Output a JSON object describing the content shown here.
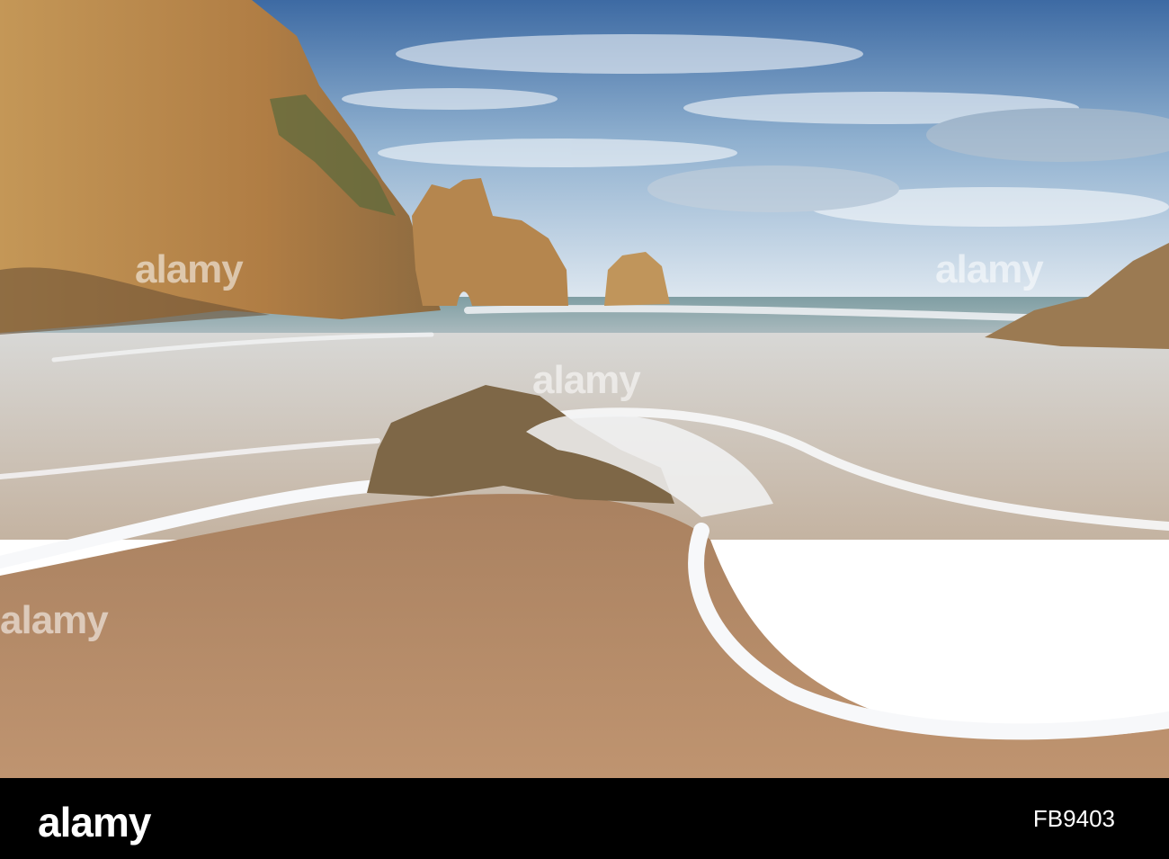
{
  "watermark": {
    "text": "alamy"
  },
  "footer": {
    "brand": "alamy",
    "stock_id": "FB9403"
  },
  "colors": {
    "sky_top": "#3f6ea6",
    "sky_bottom": "#d9e4ee",
    "cliff": "#b98a4a",
    "sand": "#b88d67",
    "foam": "#f4f6f8",
    "footer_bg": "#000000"
  }
}
